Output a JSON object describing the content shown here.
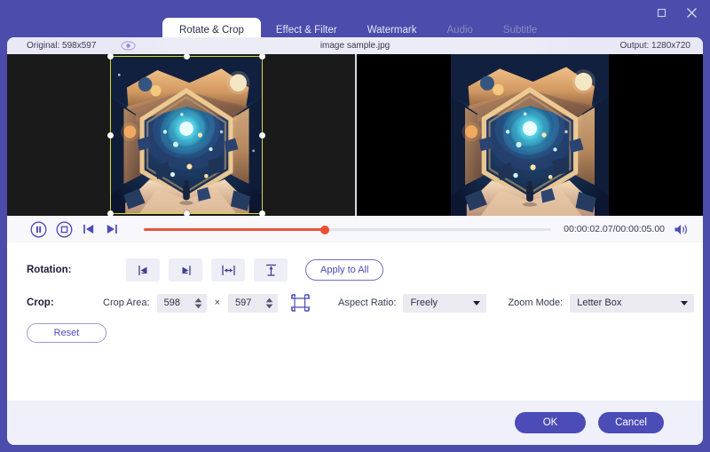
{
  "window": {
    "maximize_icon": "maximize-icon",
    "close_icon": "close-icon",
    "accent_color": "#4b4cb8",
    "titlebar_color": "#4b4cab"
  },
  "tabs": [
    {
      "label": "Rotate & Crop",
      "state": "active"
    },
    {
      "label": "Effect & Filter",
      "state": "enabled"
    },
    {
      "label": "Watermark",
      "state": "enabled"
    },
    {
      "label": "Audio",
      "state": "disabled"
    },
    {
      "label": "Subtitle",
      "state": "disabled"
    }
  ],
  "info": {
    "original": "Original: 598x597",
    "preview_toggle_icon": "eye-icon",
    "filename": "image sample.jpg",
    "output": "Output: 1280x720"
  },
  "preview": {
    "crop_border_color": "#d6dd2a",
    "left_panel_name": "original-preview",
    "right_panel_name": "output-preview"
  },
  "transport": {
    "pause_icon": "pause-icon",
    "stop_icon": "stop-icon",
    "prev_icon": "previous-frame-icon",
    "next_icon": "next-frame-icon",
    "time": "00:00:02.07/00:00:05.00",
    "volume_icon": "volume-icon",
    "progress_percent": 44.5,
    "progress_color": "#e8573f"
  },
  "rotation": {
    "label": "Rotation:",
    "buttons": [
      {
        "name": "rotate-left-button",
        "icon": "rotate-left-icon"
      },
      {
        "name": "rotate-right-button",
        "icon": "rotate-right-icon"
      },
      {
        "name": "flip-horizontal-button",
        "icon": "flip-horizontal-icon"
      },
      {
        "name": "flip-vertical-button",
        "icon": "flip-vertical-icon"
      }
    ],
    "apply_to_all": "Apply to All"
  },
  "crop": {
    "label": "Crop:",
    "area_label": "Crop Area:",
    "width": "598",
    "height": "597",
    "separator": "×",
    "grid_icon": "crop-grid-icon",
    "aspect_ratio_label": "Aspect Ratio:",
    "aspect_ratio_value": "Freely",
    "zoom_mode_label": "Zoom Mode:",
    "zoom_mode_value": "Letter Box",
    "reset": "Reset"
  },
  "footer": {
    "ok": "OK",
    "cancel": "Cancel"
  }
}
